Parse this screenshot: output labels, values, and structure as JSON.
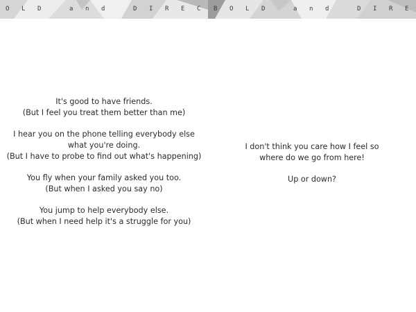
{
  "left_page": {
    "banner": "O L D  a n d  D I R E C T",
    "stanzas": [
      [
        "It's good to have friends.",
        "(But I feel you treat them better than me)"
      ],
      [
        "I hear you on the phone telling everybody else",
        "what you're doing.",
        "(But I have to probe to find out what's happening)"
      ],
      [
        "You fly when your family asked you too.",
        "(But when I asked you say no)"
      ],
      [
        "You jump to help everybody else.",
        "(But when I need help it's a struggle for you)"
      ]
    ]
  },
  "right_page": {
    "banner": "B O L D  a n d  D I R E C",
    "stanzas": [
      [
        "I don't think you care how I feel so",
        "where do we go from here!"
      ],
      [
        "Up or down?"
      ]
    ]
  },
  "colors": {
    "banner_light": "#ececec",
    "banner_mid": "#cfcfcf",
    "banner_dark": "#9a9a9a",
    "text": "#2b2b2b"
  }
}
